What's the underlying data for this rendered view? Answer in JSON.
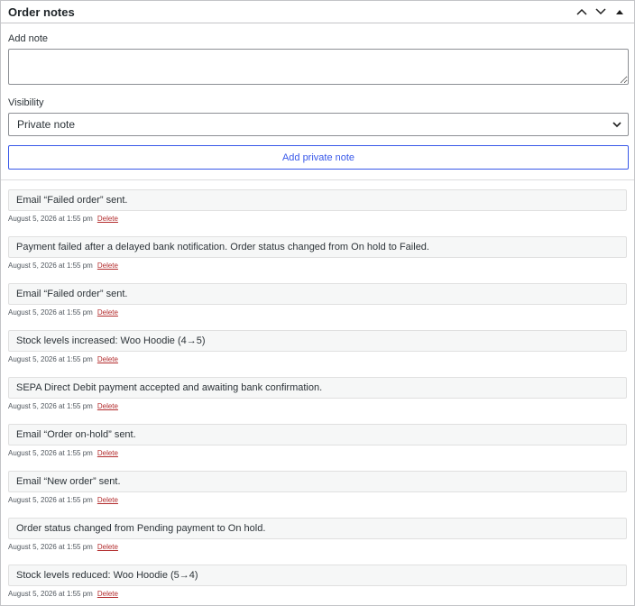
{
  "panel": {
    "title": "Order notes"
  },
  "form": {
    "add_note_label": "Add note",
    "note_value": "",
    "note_placeholder": "",
    "visibility_label": "Visibility",
    "visibility_selected": "Private note",
    "add_button_label": "Add private note"
  },
  "accent_color": "#3858e9",
  "delete_color": "#b32d2e",
  "notes": [
    {
      "text": "Email “Failed order” sent.",
      "date": "August 5, 2026 at 1:55 pm",
      "delete_label": "Delete"
    },
    {
      "text": "Payment failed after a delayed bank notification. Order status changed from On hold to Failed.",
      "date": "August 5, 2026 at 1:55 pm",
      "delete_label": "Delete"
    },
    {
      "text": "Email “Failed order” sent.",
      "date": "August 5, 2026 at 1:55 pm",
      "delete_label": "Delete"
    },
    {
      "text": "Stock levels increased: Woo Hoodie (4→5)",
      "date": "August 5, 2026 at 1:55 pm",
      "delete_label": "Delete"
    },
    {
      "text": "SEPA Direct Debit payment accepted and awaiting bank confirmation.",
      "date": "August 5, 2026 at 1:55 pm",
      "delete_label": "Delete"
    },
    {
      "text": "Email “Order on-hold” sent.",
      "date": "August 5, 2026 at 1:55 pm",
      "delete_label": "Delete"
    },
    {
      "text": "Email “New order” sent.",
      "date": "August 5, 2026 at 1:55 pm",
      "delete_label": "Delete"
    },
    {
      "text": "Order status changed from Pending payment to On hold.",
      "date": "August 5, 2026 at 1:55 pm",
      "delete_label": "Delete"
    },
    {
      "text": "Stock levels reduced: Woo Hoodie (5→4)",
      "date": "August 5, 2026 at 1:55 pm",
      "delete_label": "Delete"
    }
  ]
}
